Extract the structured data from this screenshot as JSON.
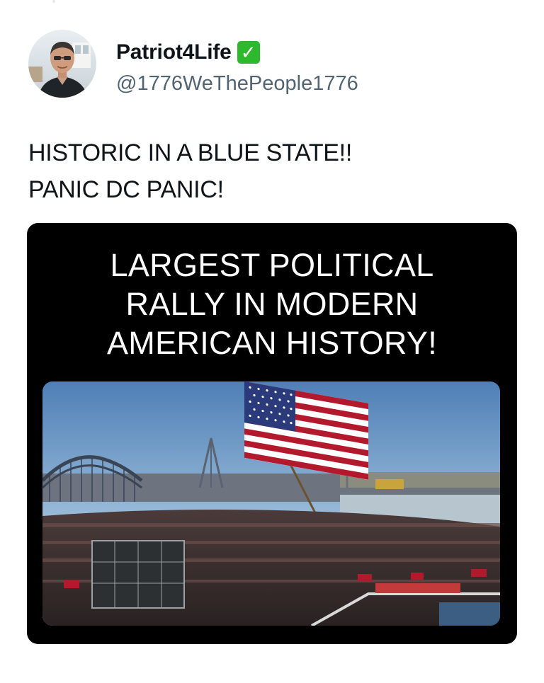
{
  "profile": {
    "display_name": "Patriot4Life",
    "verified_badge_icon": "checkmark-icon",
    "verified_glyph": "✓",
    "handle": "@1776WeThePeople1776"
  },
  "tweet": {
    "lines": [
      "HISTORIC IN A BLUE STATE!!",
      "PANIC DC PANIC!"
    ]
  },
  "media": {
    "headline_lines": [
      "LARGEST POLITICAL",
      "RALLY IN MODERN",
      "AMERICAN HISTORY!"
    ],
    "photo_description_icon": "rally-photo"
  },
  "colors": {
    "verified_badge": "#2eb82e",
    "handle": "#536471",
    "media_background": "#000000"
  }
}
